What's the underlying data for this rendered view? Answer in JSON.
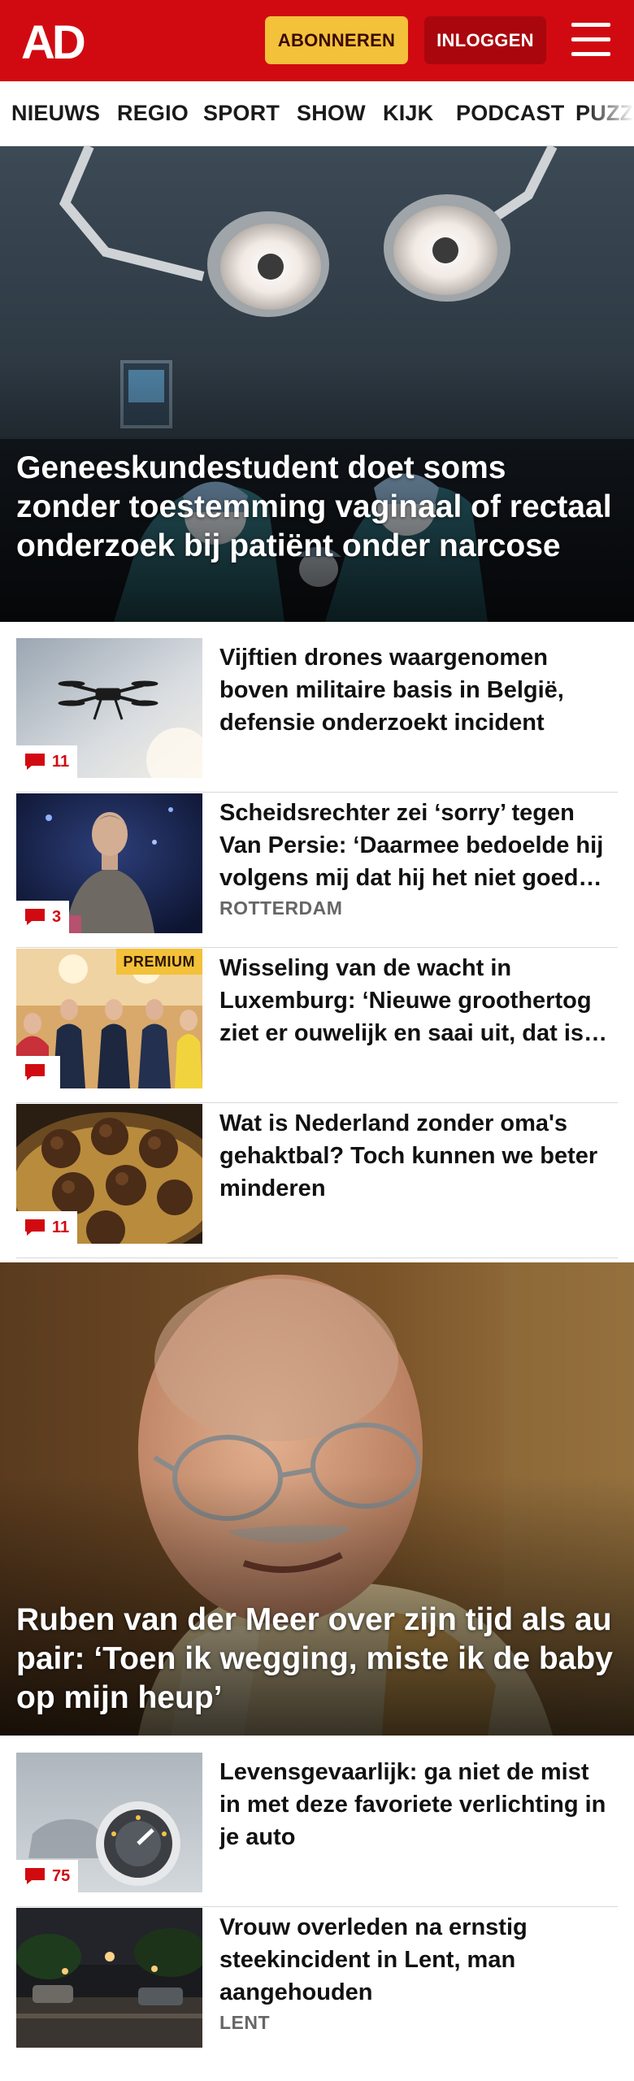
{
  "header": {
    "logo_text": "AD",
    "subscribe_label": "ABONNEREN",
    "login_label": "INLOGGEN",
    "menu_icon": "hamburger-menu-icon",
    "brand_color": "#d10a11",
    "subscribe_color": "#f3c13a"
  },
  "nav": {
    "items": [
      {
        "label": "NIEUWS"
      },
      {
        "label": "REGIO"
      },
      {
        "label": "SPORT"
      },
      {
        "label": "SHOW"
      },
      {
        "label": "KIJK"
      },
      {
        "label": "PODCAST"
      },
      {
        "label": "PUZZEL"
      }
    ]
  },
  "hero1": {
    "title": "Geneeskundestudent doet soms zonder toestemming vaginaal of rectaal onderzoek bij patiënt onder narcose"
  },
  "list1": [
    {
      "title": "Vijftien drones waargenomen boven militaire basis in België, defensie onderzoekt incident",
      "label": "",
      "comments": "11",
      "premium": ""
    },
    {
      "title": "Scheidsrechter zei ‘sorry’ tegen Van Persie: ‘Daarmee bedoelde hij volgens mij dat hij het niet goed had gedaan’",
      "label": "ROTTERDAM",
      "comments": "3",
      "premium": ""
    },
    {
      "title": "Wisseling van de wacht in Luxemburg: ‘Nieuwe groothertog ziet er ouwelijk en saai uit, dat is juist goed’",
      "label": "",
      "comments": "",
      "premium": "PREMIUM"
    },
    {
      "title": "Wat is Nederland zonder oma's gehaktbal? Toch kunnen we beter minderen",
      "label": "",
      "comments": "11",
      "premium": ""
    }
  ],
  "hero2": {
    "title": "Ruben van der Meer over zijn tijd als au pair: ‘Toen ik wegging, miste ik de baby op mijn heup’"
  },
  "list2": [
    {
      "title": "Levensgevaarlijk: ga niet de mist in met deze favoriete verlichting in je auto",
      "label": "",
      "comments": "75"
    },
    {
      "title": "Vrouw overleden na ernstig steekincident in Lent, man aangehouden",
      "label": "LENT",
      "comments": ""
    }
  ]
}
